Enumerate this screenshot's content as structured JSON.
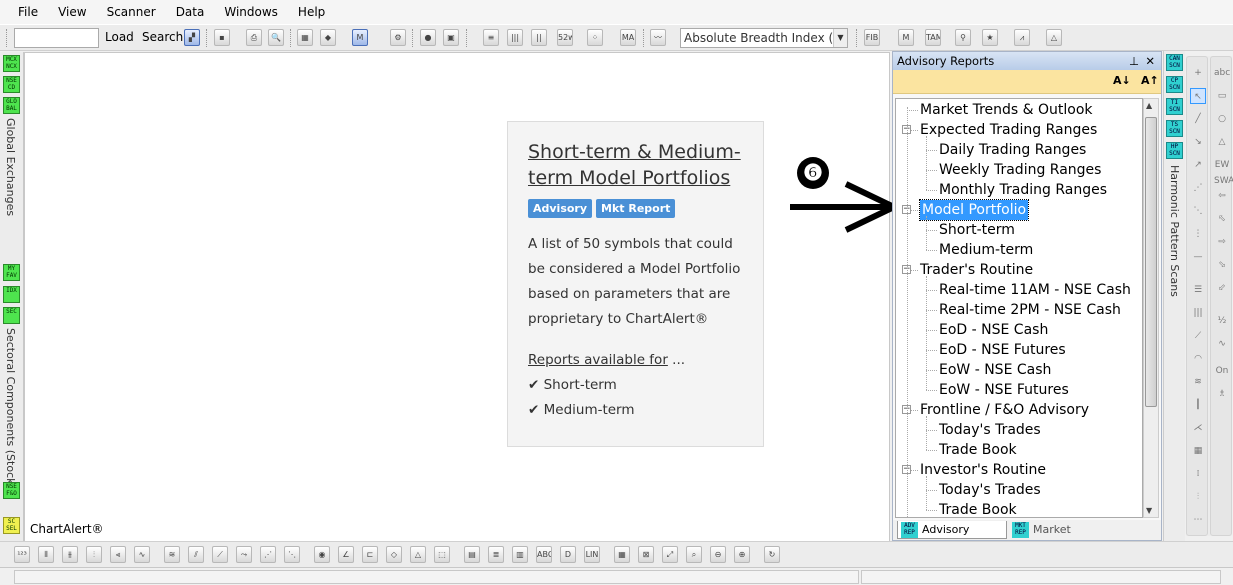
{
  "menu": [
    "File",
    "View",
    "Scanner",
    "Data",
    "Windows",
    "Help"
  ],
  "toolbar": {
    "search_value": "",
    "load_label": "Load",
    "search_label": "Search",
    "indicator_combo": "Absolute Breadth Index (ABI",
    "icons_left": [
      "52w HiLo",
      "MA",
      "AUTO FIBO",
      "M PVT",
      "C&W TAM",
      "T&S"
    ]
  },
  "left_strip": {
    "buttons_top": [
      "MCX NCX",
      "NSE CD",
      "GLO BAL"
    ],
    "label_top": "Global Exchanges",
    "buttons_mid": [
      "MY FAV",
      "IDX",
      "SEC"
    ],
    "label_mid": "Sectoral Components (Stocks)",
    "buttons_bottom": [
      "NSE F&O",
      "SC SEL"
    ]
  },
  "chart_label": "ChartAlert®",
  "card": {
    "title": "Short-term & Medium-term Model Portfolios",
    "badges": [
      "Advisory",
      "Mkt Report"
    ],
    "description": "A list of 50 symbols that could be considered a Model Portfolio based on parameters that are proprietary to ChartAlert®",
    "available_link": "Reports available for",
    "available_suffix": " ...",
    "available_items": [
      "Short-term",
      "Medium-term"
    ]
  },
  "annotation": {
    "step_number": "❻"
  },
  "panel": {
    "title": "Advisory Reports",
    "pin": "📌",
    "close": "✕",
    "sort_asc": "A↓",
    "sort_desc": "A↑",
    "tree": [
      {
        "label": "Market Trends & Outlook",
        "level": 0,
        "expander": ""
      },
      {
        "label": "Expected Trading Ranges",
        "level": 0,
        "expander": "−"
      },
      {
        "label": "Daily Trading Ranges",
        "level": 1
      },
      {
        "label": "Weekly Trading Ranges",
        "level": 1
      },
      {
        "label": "Monthly Trading Ranges",
        "level": 1
      },
      {
        "label": "Model Portfolio",
        "level": 0,
        "expander": "−",
        "selected": true
      },
      {
        "label": "Short-term",
        "level": 1
      },
      {
        "label": "Medium-term",
        "level": 1
      },
      {
        "label": "Trader's Routine",
        "level": 0,
        "expander": "−"
      },
      {
        "label": "Real-time 11AM - NSE Cash",
        "level": 1
      },
      {
        "label": "Real-time 2PM - NSE Cash",
        "level": 1
      },
      {
        "label": "EoD - NSE Cash",
        "level": 1
      },
      {
        "label": "EoD - NSE Futures",
        "level": 1
      },
      {
        "label": "EoW - NSE Cash",
        "level": 1
      },
      {
        "label": "EoW - NSE Futures",
        "level": 1
      },
      {
        "label": "Frontline / F&O Advisory",
        "level": 0,
        "expander": "−"
      },
      {
        "label": "Today's Trades",
        "level": 1
      },
      {
        "label": "Trade Book",
        "level": 1
      },
      {
        "label": "Investor's Routine",
        "level": 0,
        "expander": "−"
      },
      {
        "label": "Today's Trades",
        "level": 1
      },
      {
        "label": "Trade Book",
        "level": 1
      }
    ],
    "tabs": [
      {
        "icon": "ADV REP",
        "label": "Advisory Reports",
        "active": true
      },
      {
        "icon": "MKT REP",
        "label": "Market Reports",
        "active": false
      }
    ]
  },
  "scan_strip": {
    "buttons": [
      "CAN SCN",
      "CP SCN",
      "TI SCN",
      "TS SCN",
      "HP SCN"
    ],
    "label": "Harmonic Pattern Scans"
  },
  "draw_tools": {
    "col2_labels": [
      "abc",
      "EW SWA",
      "On"
    ]
  }
}
